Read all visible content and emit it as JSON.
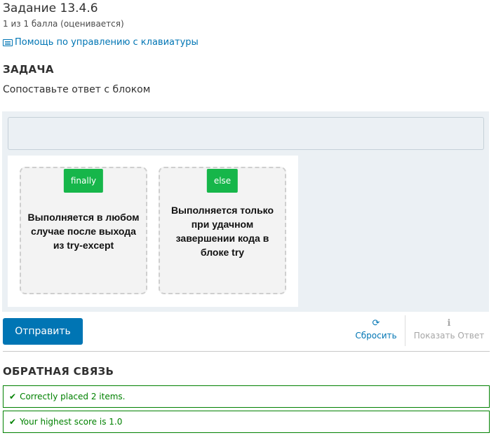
{
  "problem": {
    "title": "Задание 13.4.6",
    "score": "1 из 1 балла (оценивается)",
    "help_link": "Помощь по управлению с клавиатуры"
  },
  "task": {
    "heading": "ЗАДАЧА",
    "instruction": "Сопоставьте ответ с блоком"
  },
  "dnd": {
    "zones": [
      {
        "badge": "finally",
        "text": "Выполняется в любом случае после выхода из try-except"
      },
      {
        "badge": "else",
        "text": "Выполняется только при удачном завершении кода в блоке try"
      }
    ],
    "badge_color": "#16b64a"
  },
  "actions": {
    "submit": "Отправить",
    "reset": "Сбросить",
    "show_answer": "Показать Ответ"
  },
  "feedback": {
    "heading": "ОБРАТНАЯ СВЯЗЬ",
    "messages": [
      "Correctly placed 2 items.",
      "Your highest score is 1.0"
    ],
    "color": "#008100"
  },
  "colors": {
    "primary": "#0075b4"
  }
}
